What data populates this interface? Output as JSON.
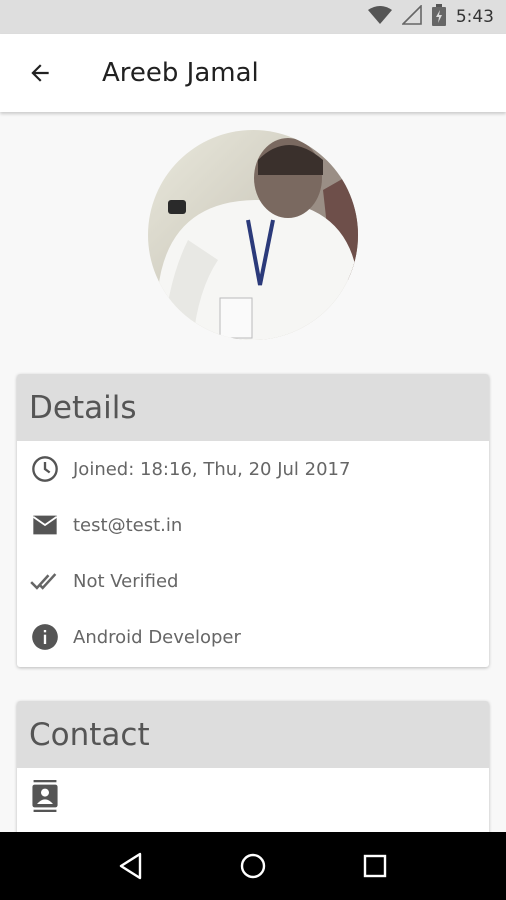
{
  "status_bar": {
    "time": "5:43"
  },
  "app_bar": {
    "title": "Areeb Jamal"
  },
  "details": {
    "header": "Details",
    "joined": "Joined: 18:16, Thu, 20 Jul 2017",
    "email": "test@test.in",
    "verified": "Not Verified",
    "role": "Android Developer"
  },
  "contact": {
    "header": "Contact"
  },
  "colors": {
    "icon": "#555555",
    "header_bg": "#dddddd"
  }
}
